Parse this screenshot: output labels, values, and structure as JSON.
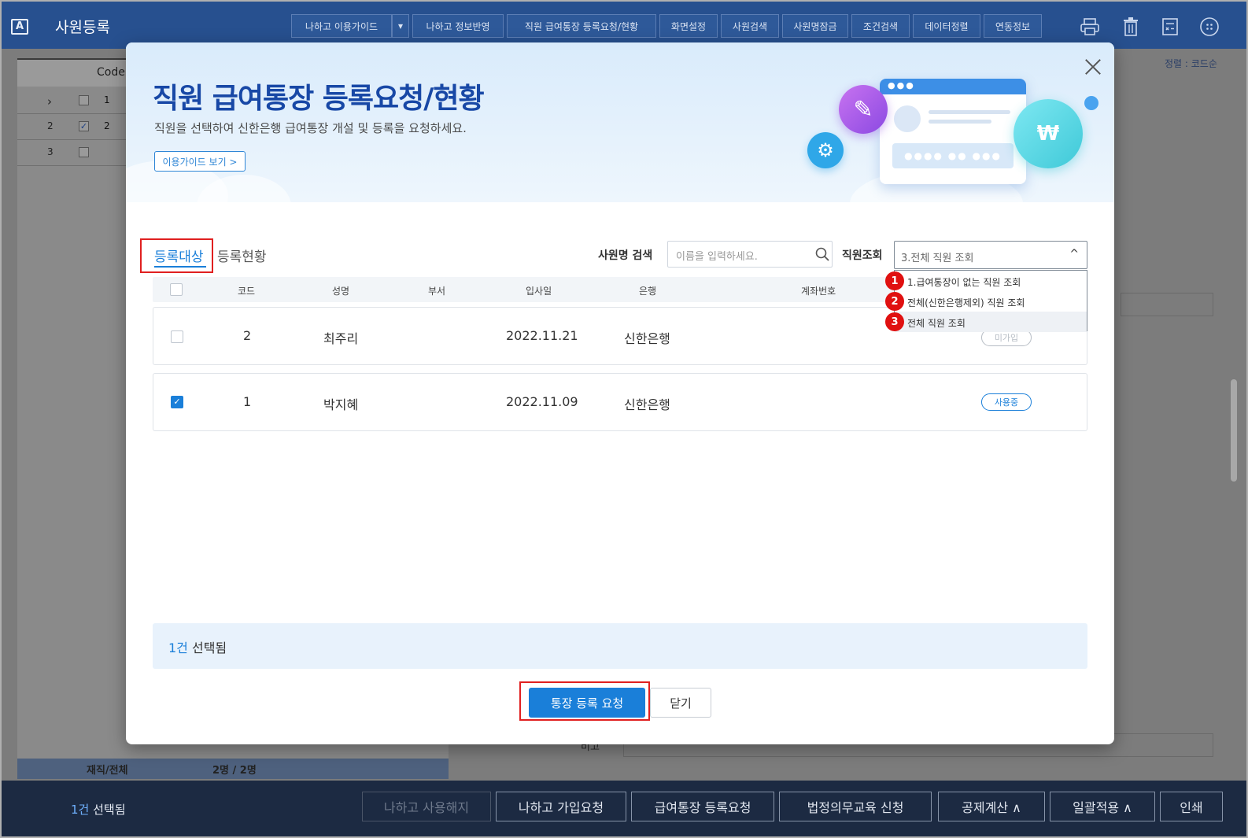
{
  "app": {
    "icon": "A",
    "title": "사원등록"
  },
  "toolbar": {
    "buttons": [
      "나하고 이용가이드",
      "▾",
      "나하고 정보반영",
      "직원 급여통장 등록요청/현황",
      "화면설정",
      "사원검색",
      "사원명잠금",
      "조건검색",
      "데이터정렬",
      "연동정보"
    ],
    "icons": [
      "print-icon",
      "trash-icon",
      "calculator-icon",
      "more-icon"
    ]
  },
  "background": {
    "grid_header_code": "Code",
    "rows": [
      {
        "num": "›",
        "checked": false,
        "code": "1"
      },
      {
        "num": "2",
        "checked": true,
        "code": "2"
      },
      {
        "num": "3",
        "checked": false,
        "code": ""
      }
    ],
    "total_label": "재직/전체",
    "total_value": "2명 / 2명",
    "sort_label": "정렬 : 코드순",
    "remark_label": "비고"
  },
  "bottombar": {
    "selection_count": "1건",
    "selection_suffix": " 선택됨",
    "buttons": [
      "나하고 사용해지",
      "나하고 가입요청",
      "급여통장 등록요청",
      "법정의무교육 신청",
      "공제계산 ∧",
      "일괄적용 ∧",
      "인쇄"
    ]
  },
  "modal": {
    "title": "직원 급여통장 등록요청/현황",
    "subtitle": "직원을 선택하여 신한은행 급여통장 개설 및 등록을 요청하세요.",
    "guide_button": "이용가이드 보기 >",
    "illustration": {
      "window_dots": "●●●",
      "password_mask": "●●●● ●● ●●●",
      "won_symbol": "₩",
      "gear_symbol": "⚙",
      "pencil_symbol": "✎"
    },
    "tabs": [
      "등록대상",
      "등록현황"
    ],
    "search_label": "사원명 검색",
    "search_placeholder": "이름을 입력하세요.",
    "filter_label": "직원조회",
    "filter_value": "3.전체 직원 조회",
    "dropdown_options": [
      {
        "badge": "1",
        "label": "1.급여통장이 없는 직원 조회"
      },
      {
        "badge": "2",
        "label": "전체(신한은행제외) 직원 조회"
      },
      {
        "badge": "3",
        "label": "전체 직원 조회"
      }
    ],
    "columns": [
      "코드",
      "성명",
      "부서",
      "입사일",
      "은행",
      "계좌번호"
    ],
    "rows": [
      {
        "checked": false,
        "code": "2",
        "name": "최주리",
        "dept": "",
        "hire_date": "2022.11.21",
        "bank": "신한은행",
        "account": "",
        "status": "미가입"
      },
      {
        "checked": true,
        "code": "1",
        "name": "박지혜",
        "dept": "",
        "hire_date": "2022.11.09",
        "bank": "신한은행",
        "account": "",
        "status": "사용중"
      }
    ],
    "selected_count": "1건",
    "selected_suffix": " 선택됨",
    "request_button": "통장 등록 요청",
    "close_button": "닫기"
  },
  "colors": {
    "accent": "#1a7fd9",
    "header_bar": "#27508f",
    "highlight": "#e02020",
    "title": "#1848a6"
  }
}
